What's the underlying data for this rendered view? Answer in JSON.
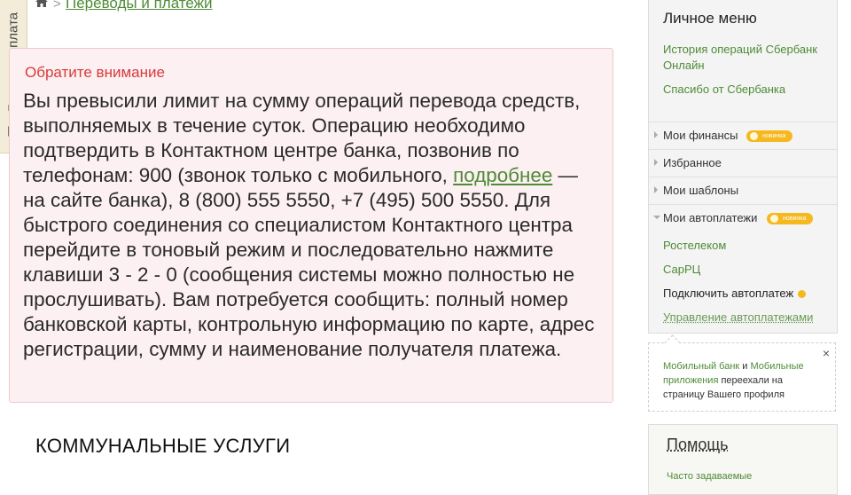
{
  "quick_pay": {
    "label": "Быстрая оплата"
  },
  "breadcrumb": {
    "separator": ">",
    "link": "Переводы и платежи"
  },
  "warning": {
    "title": "Обратите внимание",
    "text_1": "Вы превысили лимит на сумму операций перевода средств, выполняемых в течение суток. Операцию необходимо подтвердить в Контактном центре банка, позвонив по телефонам: 900 (звонок только с мобильного, ",
    "link": "подробнее",
    "text_2": " — на сайте банка), 8 (800) 555 5550, +7 (495) 500 5550. Для быстрого соединения со специалистом Контактного центра перейдите в тоновый режим и последовательно нажмите клавиши 3 - 2 - 0 (сообщения системы можно полностью не прослушивать). Вам потребуется сообщить: полный номер банковской карты, контрольную информацию по карте, адрес регистрации, сумму и наименование получателя платежа."
  },
  "section": {
    "heading": "КОММУНАЛЬНЫЕ УСЛУГИ"
  },
  "personal_menu": {
    "title": "Личное меню",
    "links": [
      "История операций Сбербанк Онлайн",
      "Спасибо от Сбербанка"
    ],
    "items": [
      {
        "label": "Мои финансы",
        "badge": "новинка"
      },
      {
        "label": "Избранное"
      },
      {
        "label": "Мои шаблоны"
      },
      {
        "label": "Мои автоплатежи",
        "badge": "новинка"
      }
    ],
    "autopayments": [
      "Ростелеком",
      "СарРЦ",
      "Подключить автоплатеж",
      "Управление автоплатежами"
    ]
  },
  "notice": {
    "close": "×",
    "link_1": "Мобильный банк",
    "conj": " и ",
    "link_2": "Мобильные приложения",
    "text": " переехали на страницу Вашего профиля"
  },
  "help": {
    "title": "Помощь",
    "link": "Часто задаваемые"
  },
  "colors": {
    "link_green": "#4e8b36",
    "warning_red": "#d93a3a",
    "warning_bg": "#fdf0f2",
    "badge": "#f5b81f"
  }
}
